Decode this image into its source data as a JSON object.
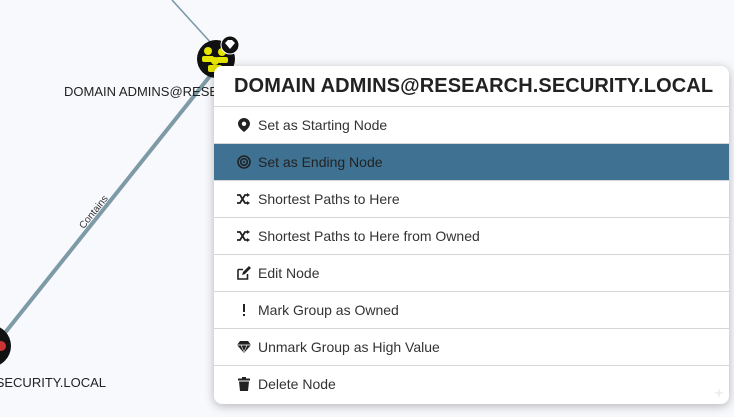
{
  "graph": {
    "nodes": [
      {
        "label": "DOMAIN ADMINS@RESEARCH.SECURITY.LOCAL",
        "icon": "group-icon",
        "badge": "high-value-diamond-icon"
      },
      {
        "label": "SECURITY.LOCAL",
        "icon": "domain-icon"
      }
    ],
    "edge_label": "Contains"
  },
  "menu": {
    "title": "DOMAIN ADMINS@RESEARCH.SECURITY.LOCAL",
    "items": [
      {
        "label": "Set as Starting Node",
        "icon": "map-marker-icon",
        "active": false
      },
      {
        "label": "Set as Ending Node",
        "icon": "bullseye-icon",
        "active": true
      },
      {
        "label": "Shortest Paths to Here",
        "icon": "random-icon",
        "active": false
      },
      {
        "label": "Shortest Paths to Here from Owned",
        "icon": "random-icon",
        "active": false
      },
      {
        "label": "Edit Node",
        "icon": "edit-icon",
        "active": false
      },
      {
        "label": "Mark Group as Owned",
        "icon": "exclamation-icon",
        "active": false
      },
      {
        "label": "Unmark Group as High Value",
        "icon": "gem-icon",
        "active": false
      },
      {
        "label": "Delete Node",
        "icon": "trash-icon",
        "active": false
      }
    ]
  },
  "colors": {
    "background": "#f7f9fc",
    "edge": "#7d9aa6",
    "active_item": "#3f7292",
    "group_node": "#e5e500",
    "node_fill": "#111111"
  }
}
